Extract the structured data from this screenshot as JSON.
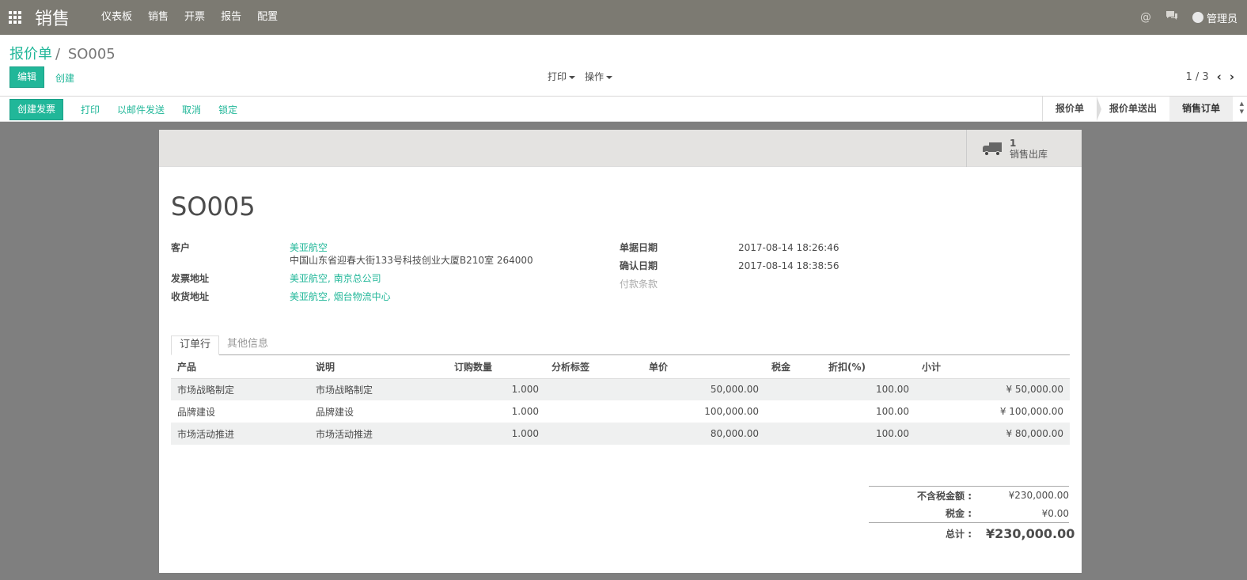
{
  "navbar": {
    "app_name": "销售",
    "menu": [
      "仪表板",
      "销售",
      "开票",
      "报告",
      "配置"
    ],
    "user": "管理员"
  },
  "breadcrumb": {
    "parent": "报价单",
    "current": "SO005"
  },
  "actions": {
    "edit": "编辑",
    "create": "创建",
    "print": "打印",
    "action": "操作"
  },
  "pager": {
    "value": "1 / 3"
  },
  "statusbar": {
    "buttons": [
      "创建发票",
      "打印",
      "以邮件发送",
      "取消",
      "锁定"
    ],
    "stages": [
      "报价单",
      "报价单送出",
      "销售订单"
    ]
  },
  "smart_button": {
    "count": "1",
    "label": "销售出库"
  },
  "record": {
    "name": "SO005",
    "customer_label": "客户",
    "customer": "美亚航空",
    "customer_address": "中国山东省迎春大街133号科技创业大厦B210室 264000",
    "invoice_label": "发票地址",
    "invoice_address": "美亚航空, 南京总公司",
    "delivery_label": "收货地址",
    "delivery_address": "美亚航空, 烟台物流中心",
    "date_order_label": "单据日期",
    "date_order": "2017-08-14 18:26:46",
    "confirm_label": "确认日期",
    "confirm_date": "2017-08-14 18:38:56",
    "payment_label": "付款条款"
  },
  "tabs": [
    "订单行",
    "其他信息"
  ],
  "table": {
    "headers": [
      "产品",
      "说明",
      "订购数量",
      "分析标签",
      "单价",
      "税金",
      "折扣(%)",
      "小计"
    ],
    "rows": [
      [
        "市场战略制定",
        "市场战略制定",
        "1.000",
        "",
        "50,000.00",
        "",
        "100.00",
        "¥ 50,000.00"
      ],
      [
        "品牌建设",
        "品牌建设",
        "1.000",
        "",
        "100,000.00",
        "",
        "100.00",
        "¥ 100,000.00"
      ],
      [
        "市场活动推进",
        "市场活动推进",
        "1.000",
        "",
        "80,000.00",
        "",
        "100.00",
        "¥ 80,000.00"
      ]
    ]
  },
  "totals": {
    "untaxed_label": "不含税金额 :",
    "untaxed": "¥230,000.00",
    "tax_label": "税金 :",
    "tax": "¥0.00",
    "total_label": "总计 :",
    "total": "¥230,000.00"
  }
}
